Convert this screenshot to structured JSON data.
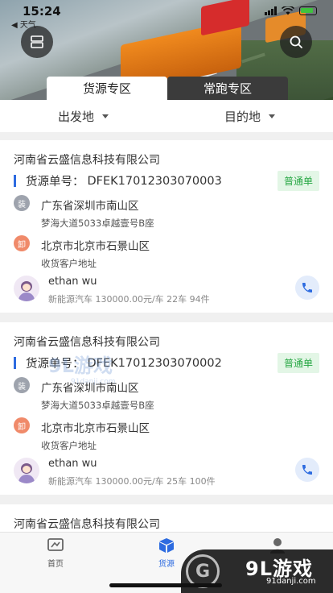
{
  "status_bar": {
    "time": "15:24",
    "back_label": "◀ 天气"
  },
  "tabs": [
    {
      "label": "货源专区",
      "active": true
    },
    {
      "label": "常跑专区",
      "active": false
    }
  ],
  "filter": {
    "origin_label": "出发地",
    "destination_label": "目的地"
  },
  "cards": [
    {
      "company": "河南省云盛信息科技有限公司",
      "order_label": "货源单号：",
      "order_no": "DFEK17012303070003",
      "badge": "普通单",
      "load_tag": "装",
      "load_city": "广东省深圳市南山区",
      "load_addr": "梦海大道5033卓越壹号B座",
      "unload_tag": "卸",
      "unload_city": "北京市北京市石景山区",
      "unload_addr": "收货客户地址",
      "person": "ethan wu",
      "meta": "新能源汽车 130000.00元/车 22车 94件"
    },
    {
      "company": "河南省云盛信息科技有限公司",
      "order_label": "货源单号：",
      "order_no": "DFEK17012303070002",
      "badge": "普通单",
      "load_tag": "装",
      "load_city": "广东省深圳市南山区",
      "load_addr": "梦海大道5033卓越壹号B座",
      "unload_tag": "卸",
      "unload_city": "北京市北京市石景山区",
      "unload_addr": "收货客户地址",
      "person": "ethan wu",
      "meta": "新能源汽车 130000.00元/车 25车 100件"
    },
    {
      "company": "河南省云盛信息科技有限公司"
    }
  ],
  "nav": {
    "home_label": "首页",
    "cargo_label": "货源"
  },
  "watermark": {
    "brand": "9L游戏",
    "url": "91danji.com",
    "mid_text": "9L游戏",
    "mid_url": "91danji.com",
    "g_mark": "G"
  },
  "colors": {
    "accent": "#2d6be0",
    "badge_bg": "#e3f6e6",
    "badge_text": "#27a744",
    "unload_dot": "#f08a6a",
    "load_dot": "#9ea3ad"
  },
  "icons": {
    "menu": "menu-icon",
    "search": "search-icon",
    "phone": "phone-icon",
    "home": "home-icon",
    "cargo": "box-icon",
    "profile": "user-icon"
  }
}
